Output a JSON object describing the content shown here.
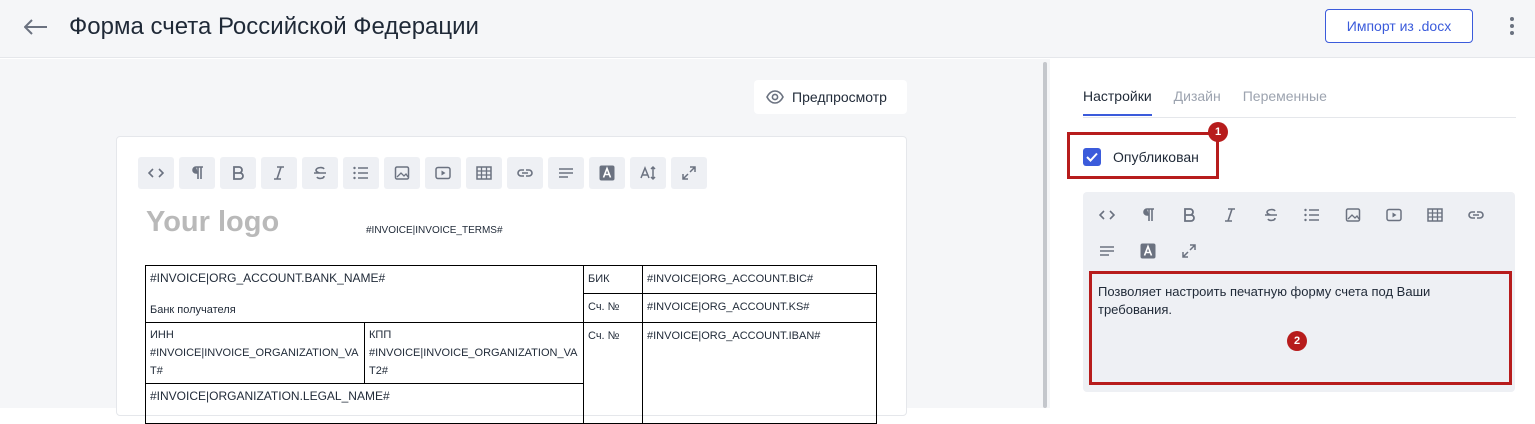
{
  "header": {
    "title": "Форма счета Российской Федерации",
    "import_label": "Импорт из .docx"
  },
  "editor": {
    "preview_label": "Предпросмотр",
    "toolbar_icons": [
      "code-icon",
      "paragraph-icon",
      "bold-icon",
      "italic-icon",
      "strikethrough-icon",
      "list-icon",
      "image-icon",
      "video-icon",
      "table-icon",
      "link-icon",
      "align-icon",
      "font-color-icon",
      "font-size-icon",
      "fullscreen-icon"
    ],
    "logo_text": "Your logo",
    "terms_var": "#INVOICE|INVOICE_TERMS#",
    "table": {
      "bank_name": "#INVOICE|ORG_ACCOUNT.BANK_NAME#",
      "bank_label": "Банк получателя",
      "bik_label": "БИК",
      "bik_value": "#INVOICE|ORG_ACCOUNT.BIC#",
      "ks_label": "Сч. №",
      "ks_value": "#INVOICE|ORG_ACCOUNT.KS#",
      "inn_label": "ИНН",
      "inn_value": "#INVOICE|INVOICE_ORGANIZATION_VAT#",
      "kpp_label": "КПП",
      "kpp_value": "#INVOICE|INVOICE_ORGANIZATION_VAT2#",
      "iban_label": "Сч. №",
      "iban_value": "#INVOICE|ORG_ACCOUNT.IBAN#",
      "legal_name": "#INVOICE|ORGANIZATION.LEGAL_NAME#"
    }
  },
  "settings": {
    "tabs": [
      {
        "label": "Настройки",
        "active": true
      },
      {
        "label": "Дизайн",
        "active": false
      },
      {
        "label": "Переменные",
        "active": false
      }
    ],
    "published_label": "Опубликован",
    "published": true,
    "description": "Позволяет настроить печатную форму счета под Ваши требования."
  },
  "annotations": {
    "badge_1": "1",
    "badge_2": "2"
  },
  "colors": {
    "accent": "#3b5bdb",
    "annotation": "#b71c1c"
  }
}
